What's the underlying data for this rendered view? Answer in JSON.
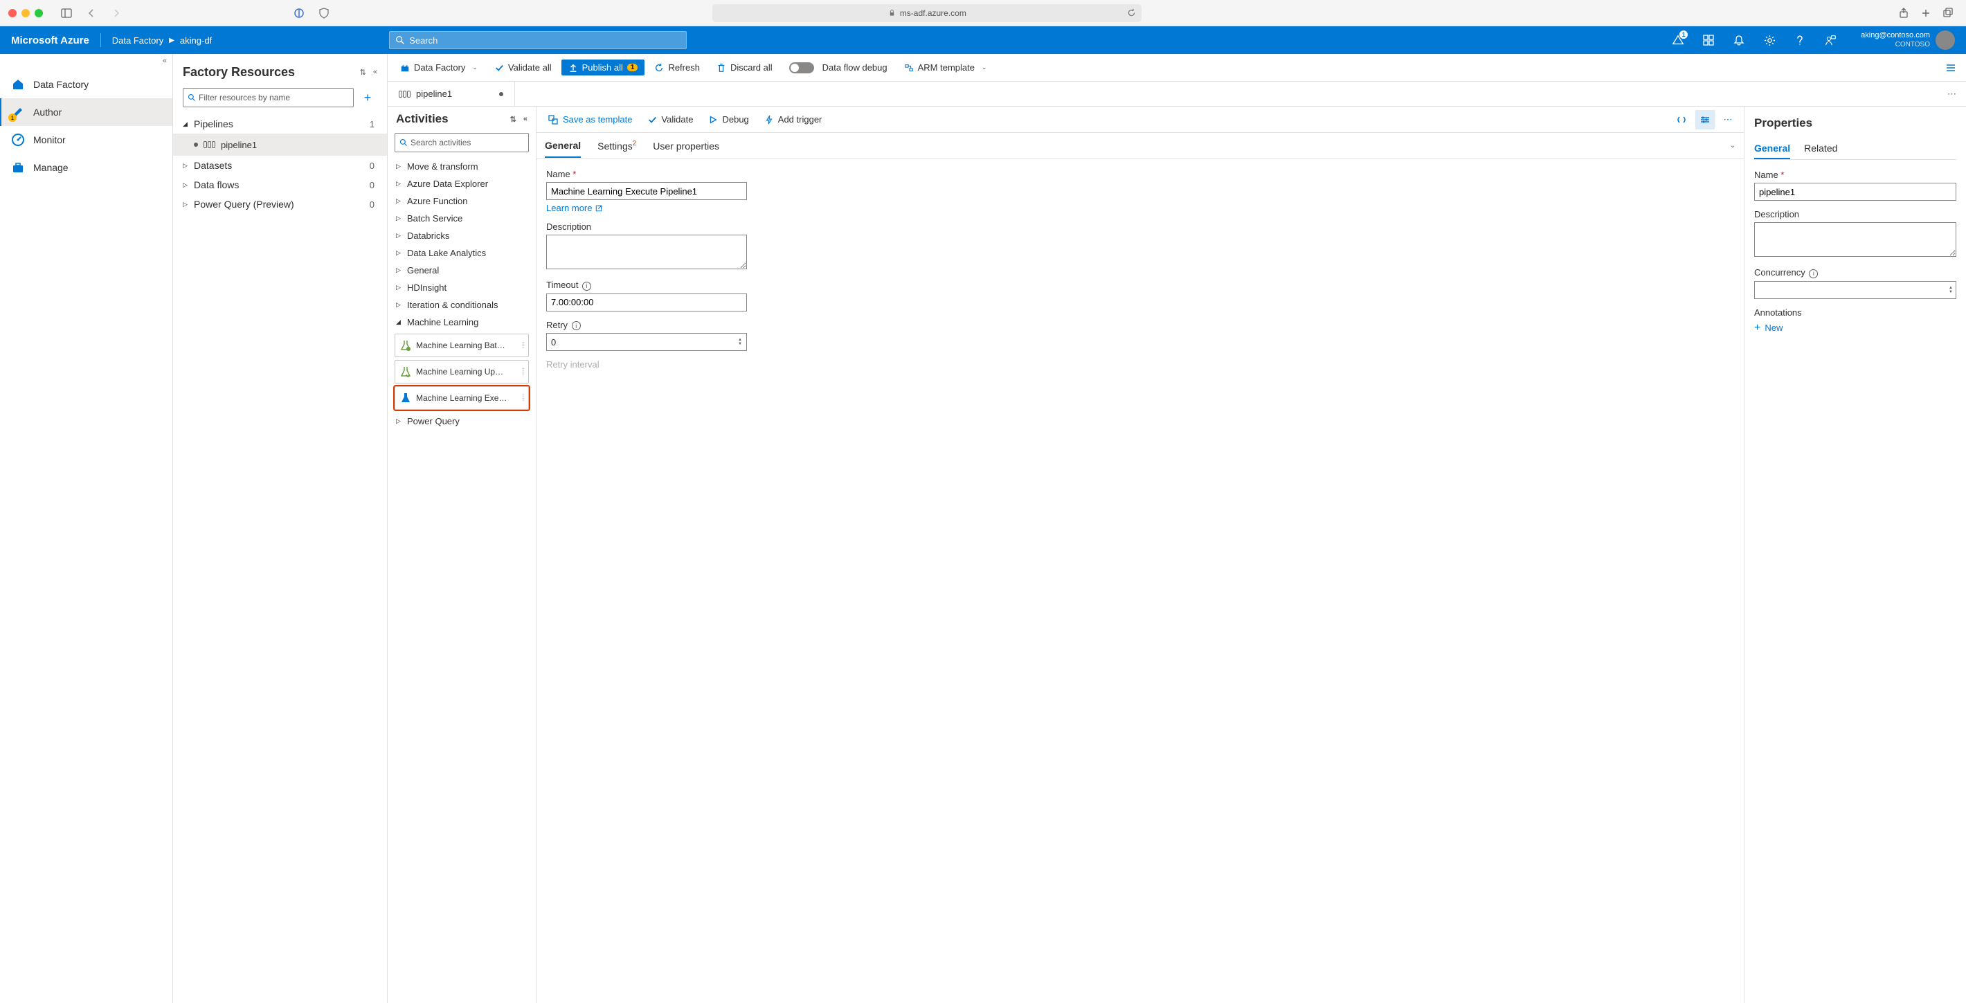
{
  "browser": {
    "url": "ms-adf.azure.com"
  },
  "header": {
    "logo": "Microsoft Azure",
    "breadcrumb": [
      "Data Factory",
      "aking-df"
    ],
    "search_placeholder": "Search",
    "notif_badge": "1",
    "account_email": "aking@contoso.com",
    "account_tenant": "CONTOSO"
  },
  "leftnav": {
    "items": [
      {
        "label": "Data Factory",
        "icon": "home"
      },
      {
        "label": "Author",
        "icon": "pencil",
        "active": true,
        "badge": "1"
      },
      {
        "label": "Monitor",
        "icon": "gauge"
      },
      {
        "label": "Manage",
        "icon": "toolbox"
      }
    ]
  },
  "resources": {
    "title": "Factory Resources",
    "filter_placeholder": "Filter resources by name",
    "tree": [
      {
        "label": "Pipelines",
        "count": "1",
        "expanded": true,
        "children": [
          {
            "label": "pipeline1",
            "dirty": true
          }
        ]
      },
      {
        "label": "Datasets",
        "count": "0"
      },
      {
        "label": "Data flows",
        "count": "0"
      },
      {
        "label": "Power Query (Preview)",
        "count": "0"
      }
    ]
  },
  "toolbar": {
    "data_factory": "Data Factory",
    "validate_all": "Validate all",
    "publish_all": "Publish all",
    "publish_count": "1",
    "refresh": "Refresh",
    "discard_all": "Discard all",
    "data_flow_debug": "Data flow debug",
    "arm_template": "ARM template"
  },
  "doc_tabs": {
    "current": "pipeline1"
  },
  "activities": {
    "title": "Activities",
    "search_placeholder": "Search activities",
    "groups": [
      "Move & transform",
      "Azure Data Explorer",
      "Azure Function",
      "Batch Service",
      "Databricks",
      "Data Lake Analytics",
      "General",
      "HDInsight",
      "Iteration & conditionals",
      "Machine Learning",
      "Power Query"
    ],
    "ml_items": [
      "Machine Learning Bat…",
      "Machine Learning Up…",
      "Machine Learning Exe…"
    ]
  },
  "action_bar": {
    "save_as_template": "Save as template",
    "validate": "Validate",
    "debug": "Debug",
    "add_trigger": "Add trigger"
  },
  "subtabs": {
    "general": "General",
    "settings": "Settings",
    "settings_badge": "2",
    "user_properties": "User properties"
  },
  "general_form": {
    "name_label": "Name",
    "name_value": "Machine Learning Execute Pipeline1",
    "learn_more": "Learn more",
    "description_label": "Description",
    "description_value": "",
    "timeout_label": "Timeout",
    "timeout_value": "7.00:00:00",
    "retry_label": "Retry",
    "retry_value": "0",
    "retry_interval_label": "Retry interval"
  },
  "properties": {
    "title": "Properties",
    "tab_general": "General",
    "tab_related": "Related",
    "name_label": "Name",
    "name_value": "pipeline1",
    "description_label": "Description",
    "description_value": "",
    "concurrency_label": "Concurrency",
    "annotations_label": "Annotations",
    "new_label": "New"
  }
}
